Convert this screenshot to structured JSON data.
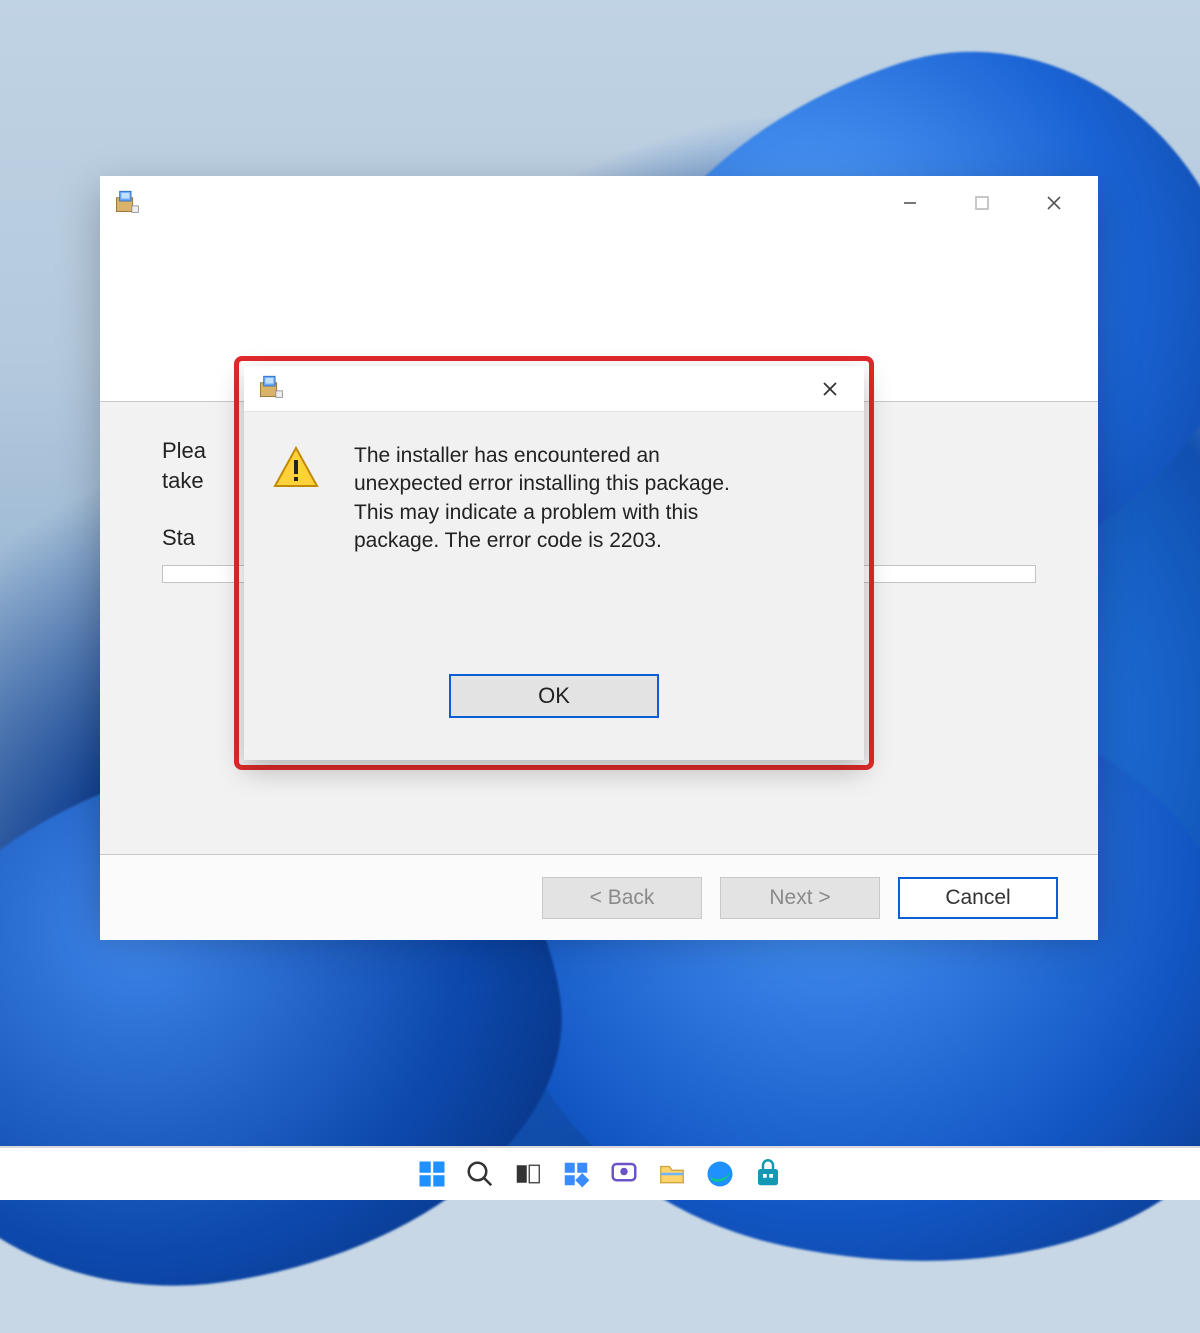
{
  "installer": {
    "please_wait_partial": "Plea",
    "take_partial": "take",
    "status_partial": "Sta",
    "buttons": {
      "back": "< Back",
      "next": "Next >",
      "cancel": "Cancel"
    }
  },
  "error_dialog": {
    "message": "The installer has encountered an unexpected error installing this package. This may indicate a problem with this package. The error code is 2203.",
    "ok_label": "OK"
  }
}
